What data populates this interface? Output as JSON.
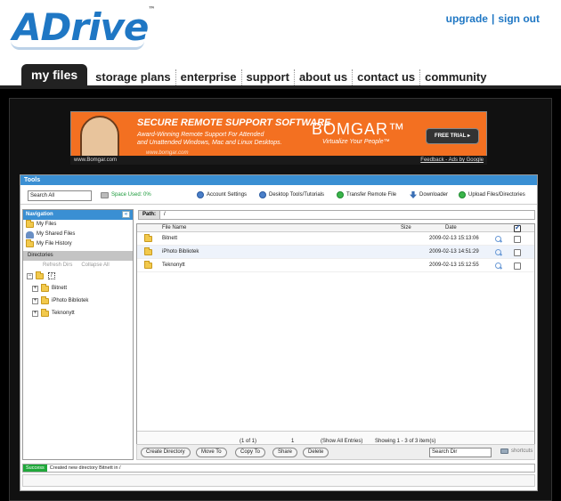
{
  "brand": {
    "logo": "ADrive",
    "trademark": "™"
  },
  "account_links": {
    "upgrade": "upgrade",
    "separator": "|",
    "sign_out": "sign out"
  },
  "main_nav": {
    "active": "my files",
    "tabs": [
      "storage plans",
      "enterprise",
      "support",
      "about us",
      "contact us",
      "community"
    ]
  },
  "ad": {
    "headline": "SECURE REMOTE SUPPORT SOFTWARE",
    "sub1": "Award-Winning Remote Support For Attended",
    "sub2": "and Unattended Windows, Mac and Linux Desktops.",
    "url": "www.bomgar.com",
    "brand": "BOMGAR™",
    "tagline": "Virtualize Your People™",
    "cta": "FREE TRIAL ▸",
    "footer_left": "www.Bomgar.com",
    "footer_right": "Feedback - Ads by Google"
  },
  "tools": {
    "header": "Tools",
    "search_value": "Search All",
    "space_used": "Space Used: 0%",
    "account_settings": "Account Settings",
    "desktop_tools": "Desktop Tools/Tutorials",
    "transfer_remote": "Transfer Remote File",
    "downloader": "Downloader",
    "upload": "Upload Files/Directories"
  },
  "navigation": {
    "header": "Navigation",
    "collapse": "«",
    "links": [
      "My Files",
      "My Shared Files",
      "My File History"
    ],
    "directories_header": "Directories",
    "refresh": "Refresh Dirs",
    "collapse_all": "Collapse All",
    "root": "/",
    "tree": [
      "Bitnett",
      "iPhoto Bibliotek",
      "Teknonytt"
    ]
  },
  "path": {
    "label": "Path:",
    "value": "/"
  },
  "grid": {
    "columns": {
      "name": "File Name",
      "size": "Size",
      "date": "Date"
    },
    "rows": [
      {
        "name": "Bitnett",
        "size": "",
        "date": "2009-02-13 15:13:06"
      },
      {
        "name": "iPhoto Bibliotek",
        "size": "",
        "date": "2009-02-13 14:51:29"
      },
      {
        "name": "Teknonytt",
        "size": "",
        "date": "2009-02-13 15:12:55"
      }
    ]
  },
  "pager": {
    "of": "(1 of 1)",
    "page": "1",
    "show_all": "(Show All Entries)",
    "summary": "Showing 1 - 3 of 3 item(s)"
  },
  "actions": {
    "create_directory": "Create Directory",
    "move_to": "Move To",
    "copy_to": "Copy To",
    "share": "Share",
    "delete": "Delete",
    "search_dir": "Search Dir",
    "shortcuts": "shortcuts"
  },
  "status": {
    "badge": "Success",
    "message": "Created new directory Bitnett in /"
  },
  "colors": {
    "brand_blue": "#1f77c4",
    "header_blue": "#3a8fd3",
    "ad_orange": "#f37021",
    "success_green": "#1fa83a"
  }
}
